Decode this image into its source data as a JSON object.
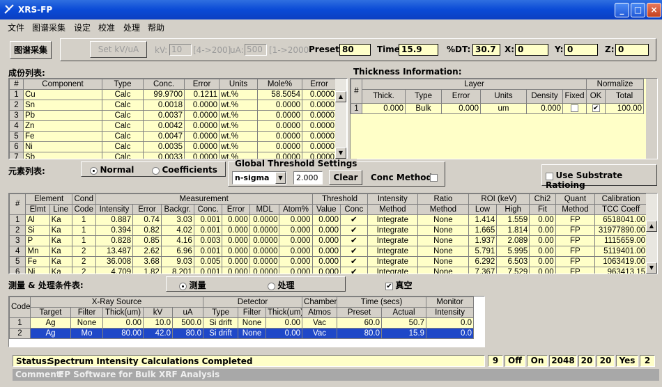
{
  "window": {
    "title": "XRS-FP",
    "controls": [
      "_",
      "□",
      "×"
    ]
  },
  "menu": [
    "文件",
    "图谱采集",
    "设定",
    "校准",
    "处理",
    "帮助"
  ],
  "toolbar": {
    "acquire": "图谱采集",
    "set_kvua": "Set kV/uA",
    "kv_label": "kV:",
    "kv_value": "10",
    "kv_range": "[4->200]",
    "ua_label": "uA:",
    "ua_value": "500",
    "ua_range": "[1->2000",
    "preset_label": "Preset:",
    "preset_value": "80",
    "time_label": "Time:",
    "time_value": "15.9",
    "dt_label": "%DT:",
    "dt_value": "30.7",
    "x_label": "X:",
    "x_value": "0",
    "y_label": "Y:",
    "y_value": "0",
    "z_label": "Z:",
    "z_value": "0"
  },
  "components": {
    "title": "成份列表:",
    "headers": [
      "#",
      "Component",
      "Type",
      "Conc.",
      "Error",
      "Units",
      "Mole%",
      "Error"
    ],
    "rows": [
      [
        "1",
        "Cu",
        "Calc",
        "99.9700",
        "0.1211",
        "wt.%",
        "58.5054",
        "0.0000"
      ],
      [
        "2",
        "Sn",
        "Calc",
        "0.0018",
        "0.0000",
        "wt.%",
        "0.0000",
        "0.0000"
      ],
      [
        "3",
        "Pb",
        "Calc",
        "0.0037",
        "0.0000",
        "wt.%",
        "0.0000",
        "0.0000"
      ],
      [
        "4",
        "Zn",
        "Calc",
        "0.0042",
        "0.0000",
        "wt.%",
        "0.0000",
        "0.0000"
      ],
      [
        "5",
        "Fe",
        "Calc",
        "0.0047",
        "0.0000",
        "wt.%",
        "0.0000",
        "0.0000"
      ],
      [
        "6",
        "Ni",
        "Calc",
        "0.0035",
        "0.0000",
        "wt.%",
        "0.0000",
        "0.0000"
      ],
      [
        "7",
        "Sb",
        "Calc",
        "0.0033",
        "0.0000",
        "wt.%",
        "0.0000",
        "0.0000"
      ]
    ]
  },
  "thickness": {
    "title": "Thickness Information:",
    "group_layer": "Layer",
    "group_normalize": "Normalize",
    "headers": [
      "#",
      "Thick.",
      "Type",
      "Error",
      "Units",
      "Density",
      "Fixed",
      "OK",
      "Total"
    ],
    "row": [
      "1",
      "0.000",
      "Bulk",
      "0.000",
      "um",
      "0.000",
      "",
      "✔",
      "100.00"
    ]
  },
  "elements_label": "元素列表:",
  "mode": {
    "normal": "Normal",
    "coefficients": "Coefficients"
  },
  "threshold": {
    "title": "Global Threshold Settings",
    "method": "n-sigma",
    "value": "2.000",
    "clear": "Clear",
    "conc_method": "Conc Method"
  },
  "substrate": "Use Substrate Ratioing",
  "elements": {
    "group_headers": [
      "#",
      "Element",
      "Cond",
      "Measurement",
      "Threshold",
      "Intensity",
      "Ratio",
      "ROI (keV)",
      "Chi2",
      "Quant",
      "Calibration"
    ],
    "headers": [
      "Elmt",
      "Line",
      "Code",
      "Intensity",
      "Error",
      "Backgr.",
      "Conc.",
      "Error",
      "MDL",
      "Atom%",
      "Value",
      "Conc",
      "Method",
      "Method",
      "Low",
      "High",
      "Fit",
      "Method",
      "TCC Coeff"
    ],
    "rows": [
      [
        "1",
        "Al",
        "Ka",
        "1",
        "0.887",
        "0.74",
        "3.03",
        "0.001",
        "0.000",
        "0.0000",
        "0.000",
        "0.000",
        "✔",
        "Integrate",
        "None",
        "1.414",
        "1.559",
        "0.00",
        "FP",
        "6518041.00"
      ],
      [
        "2",
        "Si",
        "Ka",
        "1",
        "0.394",
        "0.82",
        "4.02",
        "0.001",
        "0.000",
        "0.0000",
        "0.000",
        "0.000",
        "✔",
        "Integrate",
        "None",
        "1.665",
        "1.814",
        "0.00",
        "FP",
        "31977890.00"
      ],
      [
        "3",
        "P",
        "Ka",
        "1",
        "0.828",
        "0.85",
        "4.16",
        "0.003",
        "0.000",
        "0.0000",
        "0.000",
        "0.000",
        "✔",
        "Integrate",
        "None",
        "1.937",
        "2.089",
        "0.00",
        "FP",
        "1115659.00"
      ],
      [
        "4",
        "Mn",
        "Ka",
        "2",
        "13.487",
        "2.62",
        "6.96",
        "0.001",
        "0.000",
        "0.0000",
        "0.000",
        "0.000",
        "✔",
        "Integrate",
        "None",
        "5.791",
        "5.995",
        "0.00",
        "FP",
        "5119401.00"
      ],
      [
        "5",
        "Fe",
        "Ka",
        "2",
        "36.008",
        "3.68",
        "9.03",
        "0.005",
        "0.000",
        "0.0000",
        "0.000",
        "0.000",
        "✔",
        "Integrate",
        "None",
        "6.292",
        "6.503",
        "0.00",
        "FP",
        "1063419.00"
      ],
      [
        "6",
        "Ni",
        "Ka",
        "2",
        "4.709",
        "1.82",
        "8.201",
        "0.001",
        "0.000",
        "0.0000",
        "0.000",
        "0.000",
        "✔",
        "Integrate",
        "None",
        "7.367",
        "7.529",
        "0.00",
        "FP",
        "963413.15"
      ]
    ]
  },
  "conditions": {
    "title": "测量 & 处理条件表:",
    "opt_measure": "测量",
    "opt_process": "处理",
    "vacuum": "真空",
    "group_headers": [
      "Code",
      "X-Ray Source",
      "Detector",
      "Chamber",
      "Time (secs)",
      "Monitor"
    ],
    "headers": [
      "Target",
      "Filter",
      "Thick(um)",
      "kV",
      "uA",
      "Type",
      "Filter",
      "Thick(um)",
      "Atmos",
      "Preset",
      "Actual",
      "Intensity"
    ],
    "rows": [
      [
        "1",
        "Ag",
        "None",
        "0.00",
        "10.0",
        "500.0",
        "Si drift",
        "None",
        "0.00",
        "Vac",
        "60.0",
        "50.7",
        "0.0"
      ],
      [
        "2",
        "Ag",
        "Mo",
        "80.00",
        "42.0",
        "80.0",
        "Si drift",
        "None",
        "0.00",
        "Vac",
        "80.0",
        "15.9",
        "0.0"
      ]
    ]
  },
  "status": {
    "label": "Status:",
    "text": "Spectrum Intensity Calculations Completed",
    "cells": [
      "9",
      "Off",
      "On",
      "2048",
      "20",
      "20",
      "Yes",
      "2"
    ]
  },
  "comment": {
    "label": "Comment:",
    "text": "FP Software for Bulk XRF Analysis"
  }
}
